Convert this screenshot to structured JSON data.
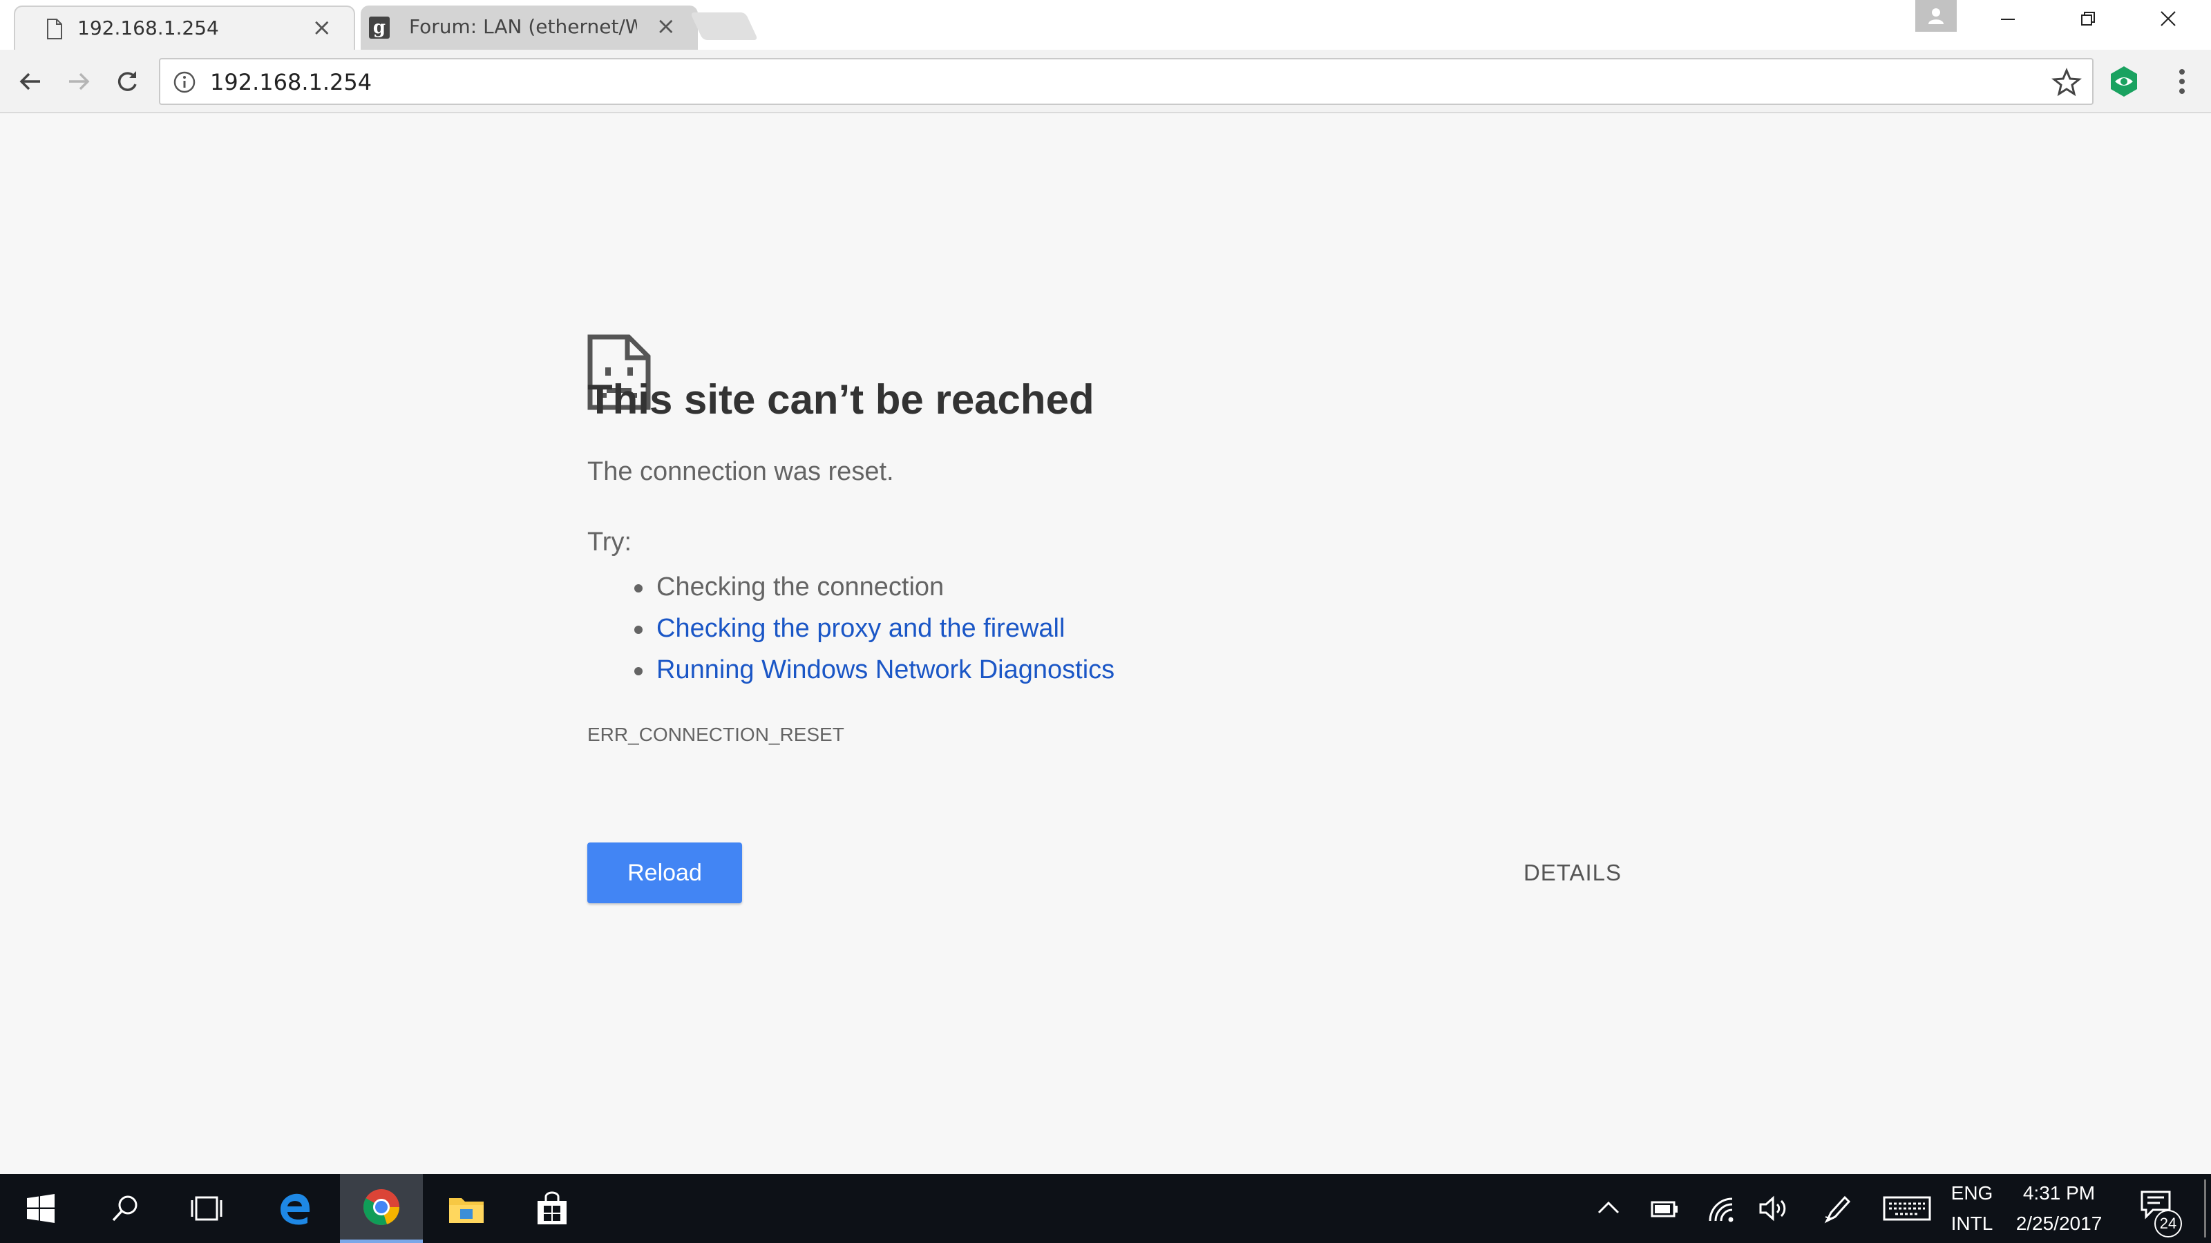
{
  "browser": {
    "tabs": [
      {
        "title": "192.168.1.254",
        "favicon": "page-icon",
        "active": true
      },
      {
        "title": "Forum: LAN (ethernet/W",
        "favicon": "g-letter-icon",
        "active": false
      }
    ],
    "omnibox_url": "192.168.1.254",
    "colors": {
      "link": "#1a56c6",
      "reload_button": "#4285f4",
      "extension_icon": "#1aa260"
    }
  },
  "error_page": {
    "headline": "This site can’t be reached",
    "message": "The connection was reset.",
    "try_label": "Try:",
    "suggestions": [
      {
        "text": "Checking the connection",
        "is_link": false
      },
      {
        "text": "Checking the proxy and the firewall",
        "is_link": true
      },
      {
        "text": "Running Windows Network Diagnostics",
        "is_link": true
      }
    ],
    "error_code": "ERR_CONNECTION_RESET",
    "reload_label": "Reload",
    "details_label": "DETAILS"
  },
  "taskbar": {
    "pinned": [
      "windows-start-icon",
      "search-icon",
      "task-view-icon",
      "edge-icon",
      "chrome-icon",
      "file-explorer-icon",
      "store-icon"
    ],
    "language_line1": "ENG",
    "language_line2": "INTL",
    "time": "4:31 PM",
    "date": "2/25/2017",
    "notification_count": "24"
  }
}
